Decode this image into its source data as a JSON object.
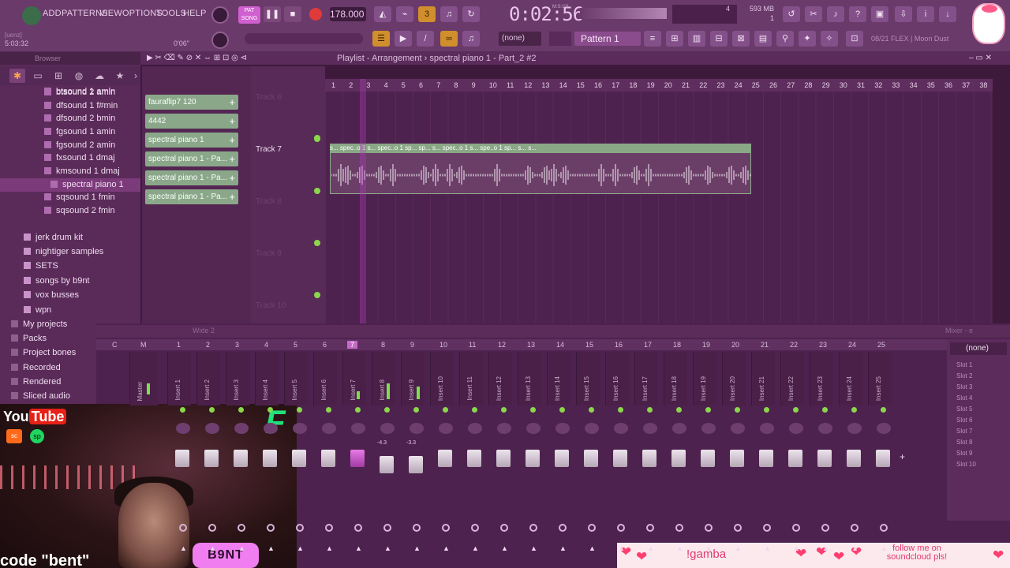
{
  "menu": [
    "ADD",
    "PATTERNS",
    "VIEW",
    "OPTIONS",
    "TOOLS",
    "HELP"
  ],
  "menu_extra": {
    "user": "[uenz]",
    "time_small": "5:03:32",
    "time_right": "0'06\""
  },
  "transport": {
    "mode_top": "PAT",
    "mode_bottom": "SONG",
    "tempo": "178.000",
    "time": "0:02:56",
    "time_label": "M:S:CS",
    "cpu": "4",
    "mem": "593 MB",
    "voices": "1"
  },
  "toolbar2": {
    "none_label": "(none)",
    "pattern": "Pattern 1",
    "hint": "08/21 FLEX | Moon Dust"
  },
  "browser": {
    "title": "Browser",
    "tab_icons": [
      "tab-all-icon",
      "tab-folder-icon",
      "tab-plugin-icon",
      "tab-world-icon",
      "tab-cloud-icon",
      "tab-star-icon"
    ],
    "items": [
      {
        "label": "btsound 1 amin",
        "type": "file",
        "sel": false
      },
      {
        "label": "btsound 2 amin",
        "type": "file",
        "sel": false
      },
      {
        "label": "dfsound 1 f#min",
        "type": "file",
        "sel": false
      },
      {
        "label": "dfsound 2 bmin",
        "type": "file",
        "sel": false
      },
      {
        "label": "fgsound 1 amin",
        "type": "file",
        "sel": false
      },
      {
        "label": "fgsound 2 amin",
        "type": "file",
        "sel": false
      },
      {
        "label": "fxsound 1 dmaj",
        "type": "file",
        "sel": false
      },
      {
        "label": "kmsound 1 dmaj",
        "type": "file",
        "sel": false
      },
      {
        "label": "spectral piano 1",
        "type": "file",
        "sel": true
      },
      {
        "label": "sqsound 1 fmin",
        "type": "file",
        "sel": false
      },
      {
        "label": "sqsound 2 fmin",
        "type": "file",
        "sel": false
      },
      {
        "label": "jerk drum kit",
        "type": "folder",
        "sel": false
      },
      {
        "label": "nightiger samples",
        "type": "folder",
        "sel": false
      },
      {
        "label": "SETS",
        "type": "folder",
        "sel": false
      },
      {
        "label": "songs by b9nt",
        "type": "folder",
        "sel": false
      },
      {
        "label": "vox busses",
        "type": "folder",
        "sel": false
      },
      {
        "label": "wpn",
        "type": "folder",
        "sel": false
      },
      {
        "label": "My projects",
        "type": "root",
        "sel": false
      },
      {
        "label": "Packs",
        "type": "root",
        "sel": false
      },
      {
        "label": "Project bones",
        "type": "root",
        "sel": false
      },
      {
        "label": "Recorded",
        "type": "root",
        "sel": false
      },
      {
        "label": "Rendered",
        "type": "root",
        "sel": false
      },
      {
        "label": "Sliced audio",
        "type": "root",
        "sel": false
      }
    ]
  },
  "playlist": {
    "title": "Playlist - Arrangement",
    "clip_path": "spectral piano 1 - Part_2 #2",
    "clips": [
      "fauraflip7 120",
      "4442",
      "spectral piano 1",
      "spectral piano 1 - Pa...",
      "spectral piano 1 - Pa...",
      "spectral piano 1 - Pa..."
    ],
    "tracks": [
      "Track 6",
      "Track 7",
      "Track 8",
      "Track 9",
      "Track 10"
    ],
    "active_track": "Track 7",
    "clip_labels": "s... spec..o 1  s...  spec..o 1  sp...  sp...  s...  spec..o 1  s...  spe..o 1  sp...  s...  s...",
    "ruler": [
      "1",
      "2",
      "3",
      "4",
      "5",
      "6",
      "7",
      "8",
      "9",
      "10",
      "11",
      "12",
      "13",
      "14",
      "15",
      "16",
      "17",
      "18",
      "19",
      "20",
      "21",
      "22",
      "23",
      "24",
      "25",
      "26",
      "27",
      "28",
      "29",
      "30",
      "31",
      "32",
      "33",
      "34",
      "35",
      "36",
      "37",
      "38"
    ]
  },
  "mixer": {
    "title": "Wide 2",
    "right_title": "Mixer - e",
    "head": [
      "C",
      "M"
    ],
    "numbers": [
      "1",
      "2",
      "3",
      "4",
      "5",
      "6",
      "7",
      "8",
      "9",
      "10",
      "11",
      "12",
      "13",
      "14",
      "15",
      "16",
      "17",
      "18",
      "19",
      "20",
      "21",
      "22",
      "23",
      "24",
      "25"
    ],
    "selected": "7",
    "master": "Master",
    "inserts": [
      "Insert 1",
      "Insert 2",
      "Insert 3",
      "Insert 4",
      "Insert 5",
      "Insert 6",
      "Insert 7",
      "Insert 8",
      "Insert 9",
      "Insert 10",
      "Insert 11",
      "Insert 12",
      "Insert 13",
      "Insert 14",
      "Insert 15",
      "Insert 16",
      "Insert 17",
      "Insert 18",
      "Insert 19",
      "Insert 20",
      "Insert 21",
      "Insert 22",
      "Insert 23",
      "Insert 24",
      "Insert 25"
    ],
    "fader_db": [
      "-4.3",
      "-3.3"
    ],
    "slot_none": "(none)",
    "slots": [
      "Slot 1",
      "Slot 2",
      "Slot 3",
      "Slot 4",
      "Slot 5",
      "Slot 6",
      "Slot 7",
      "Slot 8",
      "Slot 9",
      "Slot 10"
    ]
  },
  "overlay": {
    "youtube": "You",
    "youtube_box": "Tube",
    "soundcloud": "sc",
    "spotify": "sp",
    "code_text": "code \"bent\"",
    "b9nt": "B9NT",
    "banner_name": "!gamba",
    "banner_follow": "follow me on soundcloud pls!"
  },
  "colors": {
    "accent": "#d08f2c",
    "clip": "#8aa889",
    "selected": "#c76ac6",
    "bg": "#4e224e"
  }
}
